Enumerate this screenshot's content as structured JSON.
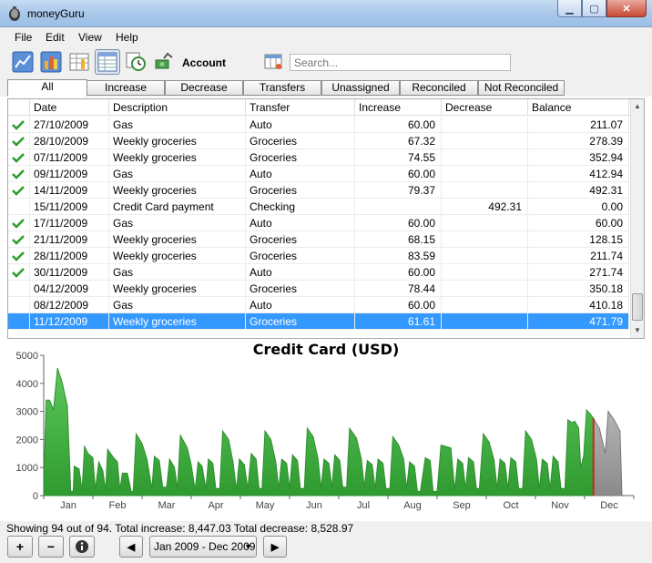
{
  "window": {
    "title": "moneyGuru"
  },
  "menus": [
    "File",
    "Edit",
    "View",
    "Help"
  ],
  "toolbar": {
    "account_label": "Account",
    "search_placeholder": "Search..."
  },
  "filters": [
    "All",
    "Increase",
    "Decrease",
    "Transfers",
    "Unassigned",
    "Reconciled",
    "Not Reconciled"
  ],
  "table": {
    "columns": [
      "Date",
      "Description",
      "Transfer",
      "Increase",
      "Decrease",
      "Balance"
    ],
    "rows": [
      {
        "reconciled": true,
        "date": "27/10/2009",
        "description": "Gas",
        "transfer": "Auto",
        "increase": "60.00",
        "decrease": "",
        "balance": "211.07"
      },
      {
        "reconciled": true,
        "date": "28/10/2009",
        "description": "Weekly groceries",
        "transfer": "Groceries",
        "increase": "67.32",
        "decrease": "",
        "balance": "278.39"
      },
      {
        "reconciled": true,
        "date": "07/11/2009",
        "description": "Weekly groceries",
        "transfer": "Groceries",
        "increase": "74.55",
        "decrease": "",
        "balance": "352.94"
      },
      {
        "reconciled": true,
        "date": "09/11/2009",
        "description": "Gas",
        "transfer": "Auto",
        "increase": "60.00",
        "decrease": "",
        "balance": "412.94"
      },
      {
        "reconciled": true,
        "date": "14/11/2009",
        "description": "Weekly groceries",
        "transfer": "Groceries",
        "increase": "79.37",
        "decrease": "",
        "balance": "492.31"
      },
      {
        "reconciled": false,
        "date": "15/11/2009",
        "description": "Credit Card payment",
        "transfer": "Checking",
        "increase": "",
        "decrease": "492.31",
        "balance": "0.00"
      },
      {
        "reconciled": true,
        "date": "17/11/2009",
        "description": "Gas",
        "transfer": "Auto",
        "increase": "60.00",
        "decrease": "",
        "balance": "60.00"
      },
      {
        "reconciled": true,
        "date": "21/11/2009",
        "description": "Weekly groceries",
        "transfer": "Groceries",
        "increase": "68.15",
        "decrease": "",
        "balance": "128.15"
      },
      {
        "reconciled": true,
        "date": "28/11/2009",
        "description": "Weekly groceries",
        "transfer": "Groceries",
        "increase": "83.59",
        "decrease": "",
        "balance": "211.74"
      },
      {
        "reconciled": true,
        "date": "30/11/2009",
        "description": "Gas",
        "transfer": "Auto",
        "increase": "60.00",
        "decrease": "",
        "balance": "271.74"
      },
      {
        "reconciled": false,
        "date": "04/12/2009",
        "description": "Weekly groceries",
        "transfer": "Groceries",
        "increase": "78.44",
        "decrease": "",
        "balance": "350.18"
      },
      {
        "reconciled": false,
        "date": "08/12/2009",
        "description": "Gas",
        "transfer": "Auto",
        "increase": "60.00",
        "decrease": "",
        "balance": "410.18"
      },
      {
        "reconciled": false,
        "date": "11/12/2009",
        "description": "Weekly groceries",
        "transfer": "Groceries",
        "increase": "61.61",
        "decrease": "",
        "balance": "471.79",
        "selected": true
      }
    ]
  },
  "chart_data": {
    "type": "area",
    "title": "Credit Card (USD)",
    "ylim": [
      0,
      5000
    ],
    "yticks": [
      0,
      1000,
      2000,
      3000,
      4000,
      5000
    ],
    "months": [
      "Jan",
      "Feb",
      "Mar",
      "Apr",
      "May",
      "Jun",
      "Jul",
      "Aug",
      "Sep",
      "Oct",
      "Nov",
      "Dec"
    ],
    "series": [
      {
        "name": "",
        "color": "#4cbb4c",
        "points": [
          [
            0.0,
            400
          ],
          [
            0.05,
            3400
          ],
          [
            0.12,
            3400
          ],
          [
            0.2,
            3050
          ],
          [
            0.28,
            4550
          ],
          [
            0.38,
            4000
          ],
          [
            0.48,
            3200
          ],
          [
            0.55,
            150
          ],
          [
            0.6,
            150
          ],
          [
            0.62,
            1050
          ],
          [
            0.72,
            950
          ],
          [
            0.78,
            200
          ],
          [
            0.83,
            1750
          ],
          [
            0.9,
            1500
          ],
          [
            1.0,
            1350
          ],
          [
            1.05,
            200
          ],
          [
            1.12,
            1200
          ],
          [
            1.2,
            900
          ],
          [
            1.26,
            200
          ],
          [
            1.3,
            1650
          ],
          [
            1.42,
            1350
          ],
          [
            1.5,
            1200
          ],
          [
            1.55,
            200
          ],
          [
            1.6,
            800
          ],
          [
            1.7,
            800
          ],
          [
            1.78,
            150
          ],
          [
            1.82,
            150
          ],
          [
            1.88,
            2200
          ],
          [
            2.0,
            1850
          ],
          [
            2.1,
            1300
          ],
          [
            2.2,
            250
          ],
          [
            2.25,
            1400
          ],
          [
            2.35,
            1250
          ],
          [
            2.42,
            300
          ],
          [
            2.5,
            300
          ],
          [
            2.56,
            1300
          ],
          [
            2.66,
            1000
          ],
          [
            2.72,
            250
          ],
          [
            2.78,
            2150
          ],
          [
            2.92,
            1700
          ],
          [
            3.0,
            1100
          ],
          [
            3.08,
            200
          ],
          [
            3.14,
            1200
          ],
          [
            3.22,
            1050
          ],
          [
            3.3,
            250
          ],
          [
            3.35,
            1300
          ],
          [
            3.44,
            1150
          ],
          [
            3.5,
            250
          ],
          [
            3.58,
            250
          ],
          [
            3.64,
            2300
          ],
          [
            3.76,
            2000
          ],
          [
            3.85,
            1200
          ],
          [
            3.92,
            200
          ],
          [
            3.98,
            1300
          ],
          [
            4.08,
            1100
          ],
          [
            4.15,
            250
          ],
          [
            4.22,
            1500
          ],
          [
            4.32,
            1300
          ],
          [
            4.38,
            250
          ],
          [
            4.44,
            250
          ],
          [
            4.5,
            2300
          ],
          [
            4.62,
            2000
          ],
          [
            4.72,
            1200
          ],
          [
            4.78,
            250
          ],
          [
            4.84,
            1300
          ],
          [
            4.94,
            1150
          ],
          [
            5.0,
            250
          ],
          [
            5.06,
            1450
          ],
          [
            5.16,
            1250
          ],
          [
            5.22,
            250
          ],
          [
            5.3,
            250
          ],
          [
            5.36,
            2400
          ],
          [
            5.48,
            2100
          ],
          [
            5.58,
            1300
          ],
          [
            5.64,
            250
          ],
          [
            5.7,
            1300
          ],
          [
            5.8,
            1150
          ],
          [
            5.86,
            300
          ],
          [
            5.92,
            1450
          ],
          [
            6.02,
            1250
          ],
          [
            6.08,
            300
          ],
          [
            6.16,
            300
          ],
          [
            6.22,
            2400
          ],
          [
            6.36,
            2050
          ],
          [
            6.46,
            1300
          ],
          [
            6.52,
            300
          ],
          [
            6.58,
            1250
          ],
          [
            6.68,
            1100
          ],
          [
            6.74,
            250
          ],
          [
            6.8,
            1300
          ],
          [
            6.9,
            1150
          ],
          [
            6.96,
            250
          ],
          [
            7.04,
            250
          ],
          [
            7.1,
            2100
          ],
          [
            7.22,
            1800
          ],
          [
            7.32,
            1300
          ],
          [
            7.38,
            250
          ],
          [
            7.44,
            1200
          ],
          [
            7.54,
            1050
          ],
          [
            7.6,
            150
          ],
          [
            7.66,
            150
          ],
          [
            7.76,
            1350
          ],
          [
            7.86,
            1250
          ],
          [
            7.92,
            150
          ],
          [
            8.0,
            150
          ],
          [
            8.08,
            1800
          ],
          [
            8.18,
            1750
          ],
          [
            8.28,
            1700
          ],
          [
            8.36,
            200
          ],
          [
            8.42,
            1300
          ],
          [
            8.52,
            1150
          ],
          [
            8.58,
            250
          ],
          [
            8.64,
            1350
          ],
          [
            8.74,
            1200
          ],
          [
            8.8,
            250
          ],
          [
            8.86,
            250
          ],
          [
            8.94,
            2200
          ],
          [
            9.06,
            1900
          ],
          [
            9.16,
            1250
          ],
          [
            9.22,
            250
          ],
          [
            9.28,
            1300
          ],
          [
            9.38,
            1150
          ],
          [
            9.44,
            250
          ],
          [
            9.5,
            1350
          ],
          [
            9.6,
            1200
          ],
          [
            9.66,
            250
          ],
          [
            9.74,
            250
          ],
          [
            9.8,
            2300
          ],
          [
            9.92,
            2000
          ],
          [
            10.02,
            1300
          ],
          [
            10.08,
            250
          ],
          [
            10.14,
            1300
          ],
          [
            10.24,
            1150
          ],
          [
            10.3,
            250
          ],
          [
            10.36,
            1400
          ],
          [
            10.46,
            1200
          ],
          [
            10.52,
            250
          ],
          [
            10.6,
            250
          ],
          [
            10.66,
            2700
          ],
          [
            10.74,
            2600
          ],
          [
            10.8,
            2650
          ],
          [
            10.88,
            2400
          ],
          [
            10.92,
            1000
          ],
          [
            10.98,
            1400
          ],
          [
            11.04,
            3050
          ],
          [
            11.12,
            2900
          ],
          [
            11.18,
            2750
          ]
        ]
      },
      {
        "name": "",
        "color": "#a0a0a0",
        "points": [
          [
            11.18,
            2750
          ],
          [
            11.3,
            2400
          ],
          [
            11.42,
            1500
          ],
          [
            11.48,
            3000
          ],
          [
            11.6,
            2700
          ],
          [
            11.72,
            2300
          ],
          [
            11.76,
            0
          ]
        ]
      }
    ],
    "today_marker": 11.18,
    "grid": false
  },
  "status": {
    "summary": "Showing 94 out of 94. Total increase: 8,447.03 Total decrease: 8,528.97",
    "date_range": "Jan 2009 - Dec 2009",
    "add_label": "+",
    "remove_label": "−"
  }
}
